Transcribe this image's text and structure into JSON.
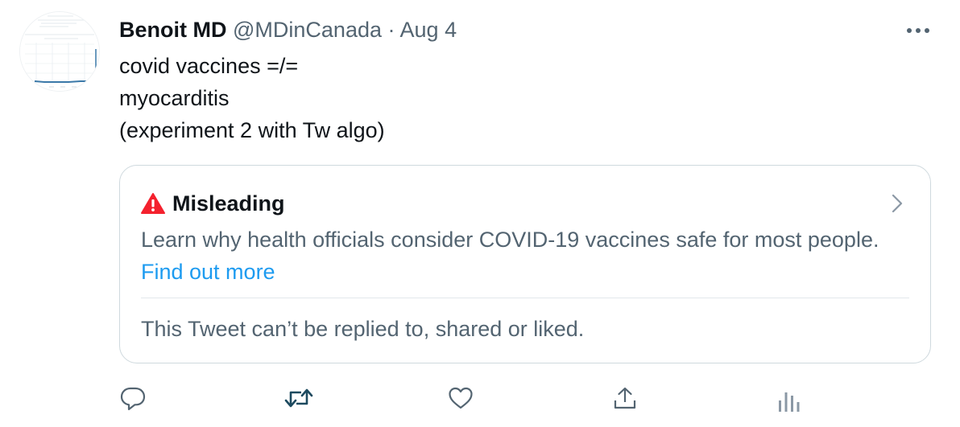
{
  "tweet": {
    "author_name": "Benoit MD",
    "author_handle": "@MDinCanada",
    "separator": "·",
    "date": "Aug 4",
    "lines": [
      "covid vaccines =/=",
      "myocarditis",
      "(experiment 2 with Tw algo)"
    ]
  },
  "notice": {
    "label": "Misleading",
    "description": "Learn why health officials consider COVID-19 vaccines safe for most people.",
    "link_text": "Find out more",
    "restriction": "This Tweet can’t be replied to, shared or liked."
  },
  "icons": {
    "more": "more-horizontal-icon",
    "warning": "warning-triangle-icon",
    "chevron": "chevron-right-icon",
    "reply": "reply-icon",
    "retweet": "retweet-icon",
    "like": "like-icon",
    "share": "share-icon",
    "analytics": "analytics-icon"
  },
  "colors": {
    "text": "#0f1419",
    "secondary": "#536471",
    "link": "#1d9bf0",
    "warning": "#f4212e",
    "border": "#cfd9de",
    "retweet_icon": "#1d4a5f"
  }
}
